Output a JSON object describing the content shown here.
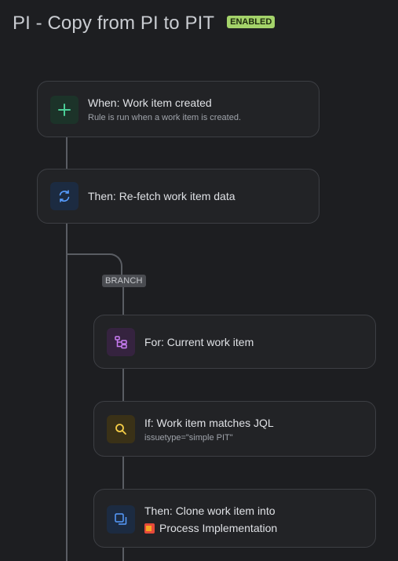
{
  "header": {
    "title": "PI - Copy from PI to PIT",
    "status": "ENABLED"
  },
  "branch_label": "BRANCH",
  "steps": [
    {
      "title": "When: Work item created",
      "subtitle": "Rule is run when a work item is created.",
      "icon": "plus-icon",
      "color": "#4bce97"
    },
    {
      "title": "Then: Re-fetch work item data",
      "icon": "refresh-icon",
      "color": "#579dff"
    },
    {
      "title": "For: Current work item",
      "icon": "branch-tree-icon",
      "color": "#c97cf4"
    },
    {
      "title": "If: Work item matches JQL",
      "subtitle": "issuetype=\"simple PIT\"",
      "icon": "search-icon",
      "color": "#f5cd47"
    },
    {
      "title": "Then: Clone work item into",
      "subtitle": "Process Implementation",
      "icon": "clone-icon",
      "color": "#579dff"
    }
  ]
}
